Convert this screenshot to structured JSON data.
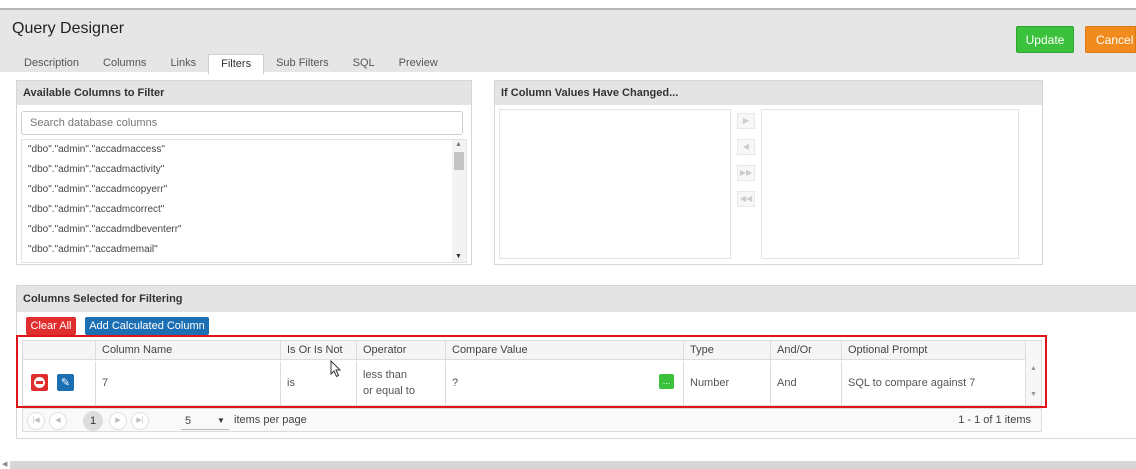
{
  "header": {
    "title": "Query Designer",
    "update_label": "Update",
    "cancel_label": "Cancel"
  },
  "tabs": [
    {
      "label": "Description"
    },
    {
      "label": "Columns"
    },
    {
      "label": "Links"
    },
    {
      "label": "Filters",
      "active": true
    },
    {
      "label": "Sub Filters"
    },
    {
      "label": "SQL"
    },
    {
      "label": "Preview"
    }
  ],
  "available": {
    "title": "Available Columns to Filter",
    "search_placeholder": "Search database columns",
    "items": [
      "\"dbo\".\"admin\".\"accadmaccess\"",
      "\"dbo\".\"admin\".\"accadmactivity\"",
      "\"dbo\".\"admin\".\"accadmcopyerr\"",
      "\"dbo\".\"admin\".\"accadmcorrect\"",
      "\"dbo\".\"admin\".\"accadmdbeventerr\"",
      "\"dbo\".\"admin\".\"accadmemail\""
    ]
  },
  "changed": {
    "title": "If Column Values Have Changed..."
  },
  "selected": {
    "title": "Columns Selected for Filtering",
    "clear_all_label": "Clear All",
    "add_calc_label": "Add Calculated Column",
    "columns": [
      "Column Name",
      "Is Or Is Not",
      "Operator",
      "Compare Value",
      "Type",
      "And/Or",
      "Optional Prompt"
    ],
    "rows": [
      {
        "column_name": "7",
        "is_or_is_not": "is",
        "operator": "less than or equal to",
        "compare_value": "?",
        "type": "Number",
        "and_or": "And",
        "optional_prompt": "SQL to compare against 7"
      }
    ],
    "compare_button": "...",
    "pager": {
      "current_page": "1",
      "page_size": "5",
      "items_per_page_label": "items per page",
      "info": "1 - 1 of 1 items"
    }
  },
  "colors": {
    "update": "#3cc13c",
    "cancel": "#f28b1e",
    "clear_all": "#e02d2d",
    "add_calc": "#1d6fb3",
    "highlight": "#e0141b"
  }
}
